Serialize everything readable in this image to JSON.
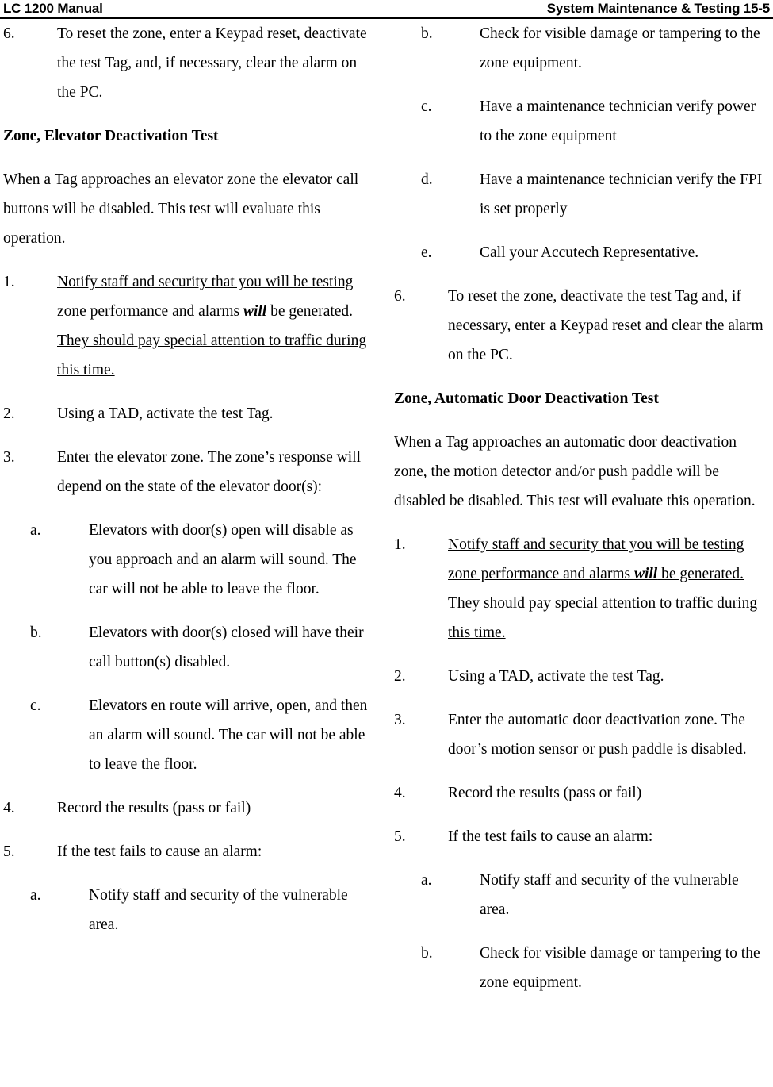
{
  "header": {
    "left": "LC 1200 Manual",
    "right": "System Maintenance & Testing 15-5"
  },
  "left_column": {
    "item6": {
      "marker": "6.",
      "text": "To reset the zone, enter a Keypad reset, deactivate the test Tag, and, if necessary, clear the alarm on the PC."
    },
    "heading": "Zone, Elevator Deactivation Test",
    "intro": "When a Tag approaches an elevator zone the elevator call buttons will be disabled. This test will evaluate this operation.",
    "steps": [
      {
        "marker": "1.",
        "underlined": true,
        "text_before": "Notify staff and security that you will be testing zone performance and alarms ",
        "emphasis": "will",
        "text_after": " be generated. They should pay special attention to traffic during this time."
      },
      {
        "marker": "2.",
        "text": "Using a TAD, activate the test Tag."
      },
      {
        "marker": "3.",
        "text": "Enter the elevator zone. The zone’s response will depend on the state of the elevator door(s):"
      }
    ],
    "substeps_3": [
      {
        "marker": "a.",
        "text": "Elevators with door(s) open will disable as you approach and an alarm will sound. The car will not be able to leave the floor."
      },
      {
        "marker": "b.",
        "text": "Elevators with door(s) closed will have their call button(s) disabled."
      },
      {
        "marker": "c.",
        "text": "Elevators en route will arrive, open, and then an alarm will sound. The car will not be able to leave the floor."
      }
    ],
    "steps_tail": [
      {
        "marker": "4.",
        "text": "Record the results (pass or fail)"
      },
      {
        "marker": "5.",
        "text": "If the test fails to cause an alarm:"
      }
    ],
    "substeps_5": [
      {
        "marker": "a.",
        "text": "Notify staff and security of the vulnerable area."
      }
    ]
  },
  "right_column": {
    "substeps_5_cont": [
      {
        "marker": "b.",
        "text": "Check for visible damage or tampering to the zone equipment."
      },
      {
        "marker": "c.",
        "text": "Have a maintenance technician verify power to the zone equipment"
      },
      {
        "marker": "d.",
        "text": "Have a maintenance technician verify the FPI is set properly"
      },
      {
        "marker": "e.",
        "text": "Call your Accutech Representative."
      }
    ],
    "item6": {
      "marker": "6.",
      "text": "To reset the zone, deactivate the test Tag and, if necessary, enter a Keypad reset and clear the alarm on the PC."
    },
    "heading": "Zone, Automatic Door Deactivation Test",
    "intro": "When a Tag approaches an automatic door deactivation zone, the motion detector and/or push paddle will be disabled be disabled. This test will evaluate this operation.",
    "steps": [
      {
        "marker": "1.",
        "underlined": true,
        "text_before": "Notify staff and security that you will be testing zone performance and alarms ",
        "emphasis": "will",
        "text_after": " be generated. They should pay special attention to traffic during this time."
      },
      {
        "marker": "2.",
        "text": "Using a TAD, activate the test Tag."
      },
      {
        "marker": "3.",
        "text": "Enter the automatic door deactivation zone. The door’s motion sensor or push paddle is disabled."
      },
      {
        "marker": "4.",
        "text": "Record the results (pass or fail)"
      },
      {
        "marker": "5.",
        "text": "If the test fails to cause an alarm:"
      }
    ],
    "substeps_5": [
      {
        "marker": "a.",
        "text": "Notify staff and security of the vulnerable area."
      },
      {
        "marker": "b.",
        "text": "Check for visible damage or tampering to the zone equipment."
      }
    ]
  }
}
